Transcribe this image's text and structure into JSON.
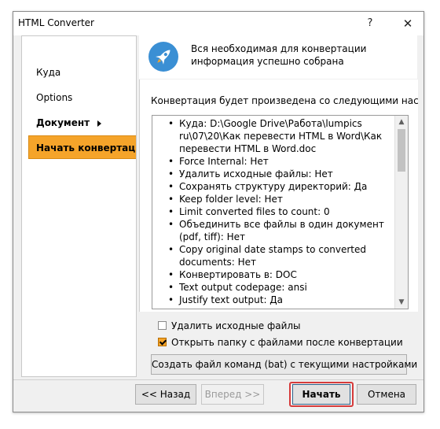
{
  "window": {
    "title": "HTML Converter",
    "help_glyph": "?",
    "close_glyph": "✕"
  },
  "sidebar": {
    "items": [
      {
        "label": "Куда"
      },
      {
        "label": "Options"
      },
      {
        "label": "Документ"
      },
      {
        "label": "Начать конвертацию"
      }
    ]
  },
  "header": {
    "icon": "rocket-icon",
    "line1": "Вся необходимая для конвертации",
    "line2": "информация успешно собрана"
  },
  "main": {
    "intro": "Конвертация будет произведена со следующими настрой",
    "summary": [
      "Куда: D:\\Google Drive\\Работа\\lumpics ru\\07\\20\\Как перевести HTML в Word\\Как перевести HTML в Word.doc",
      "Force Internal: Нет",
      "Удалить исходные файлы: Нет",
      "Сохранять структуру директорий: Да",
      "Keep folder level: Нет",
      "Limit converted files to count: 0",
      "Объединить все файлы в один документ (pdf, tiff): Нет",
      "Copy original date stamps to converted documents: Нет",
      "Конвертировать в: DOC",
      "Text output codepage: ansi",
      "Justify text output: Да"
    ],
    "scroll_up_glyph": "▲",
    "scroll_down_glyph": "▼"
  },
  "options": {
    "delete_source": {
      "label": "Удалить исходные файлы",
      "checked": false
    },
    "open_folder": {
      "label": "Открыть папку с файлами после конвертации",
      "checked": true
    }
  },
  "buttons": {
    "bat": "Создать файл команд (bat) с текущими настройками",
    "back": "<< Назад",
    "next": "Вперед >>",
    "start": "Начать",
    "cancel": "Отмена"
  },
  "colors": {
    "accent": "#f5a42a",
    "highlight": "#d63b3b",
    "icon_blue": "#3a8fd4"
  }
}
